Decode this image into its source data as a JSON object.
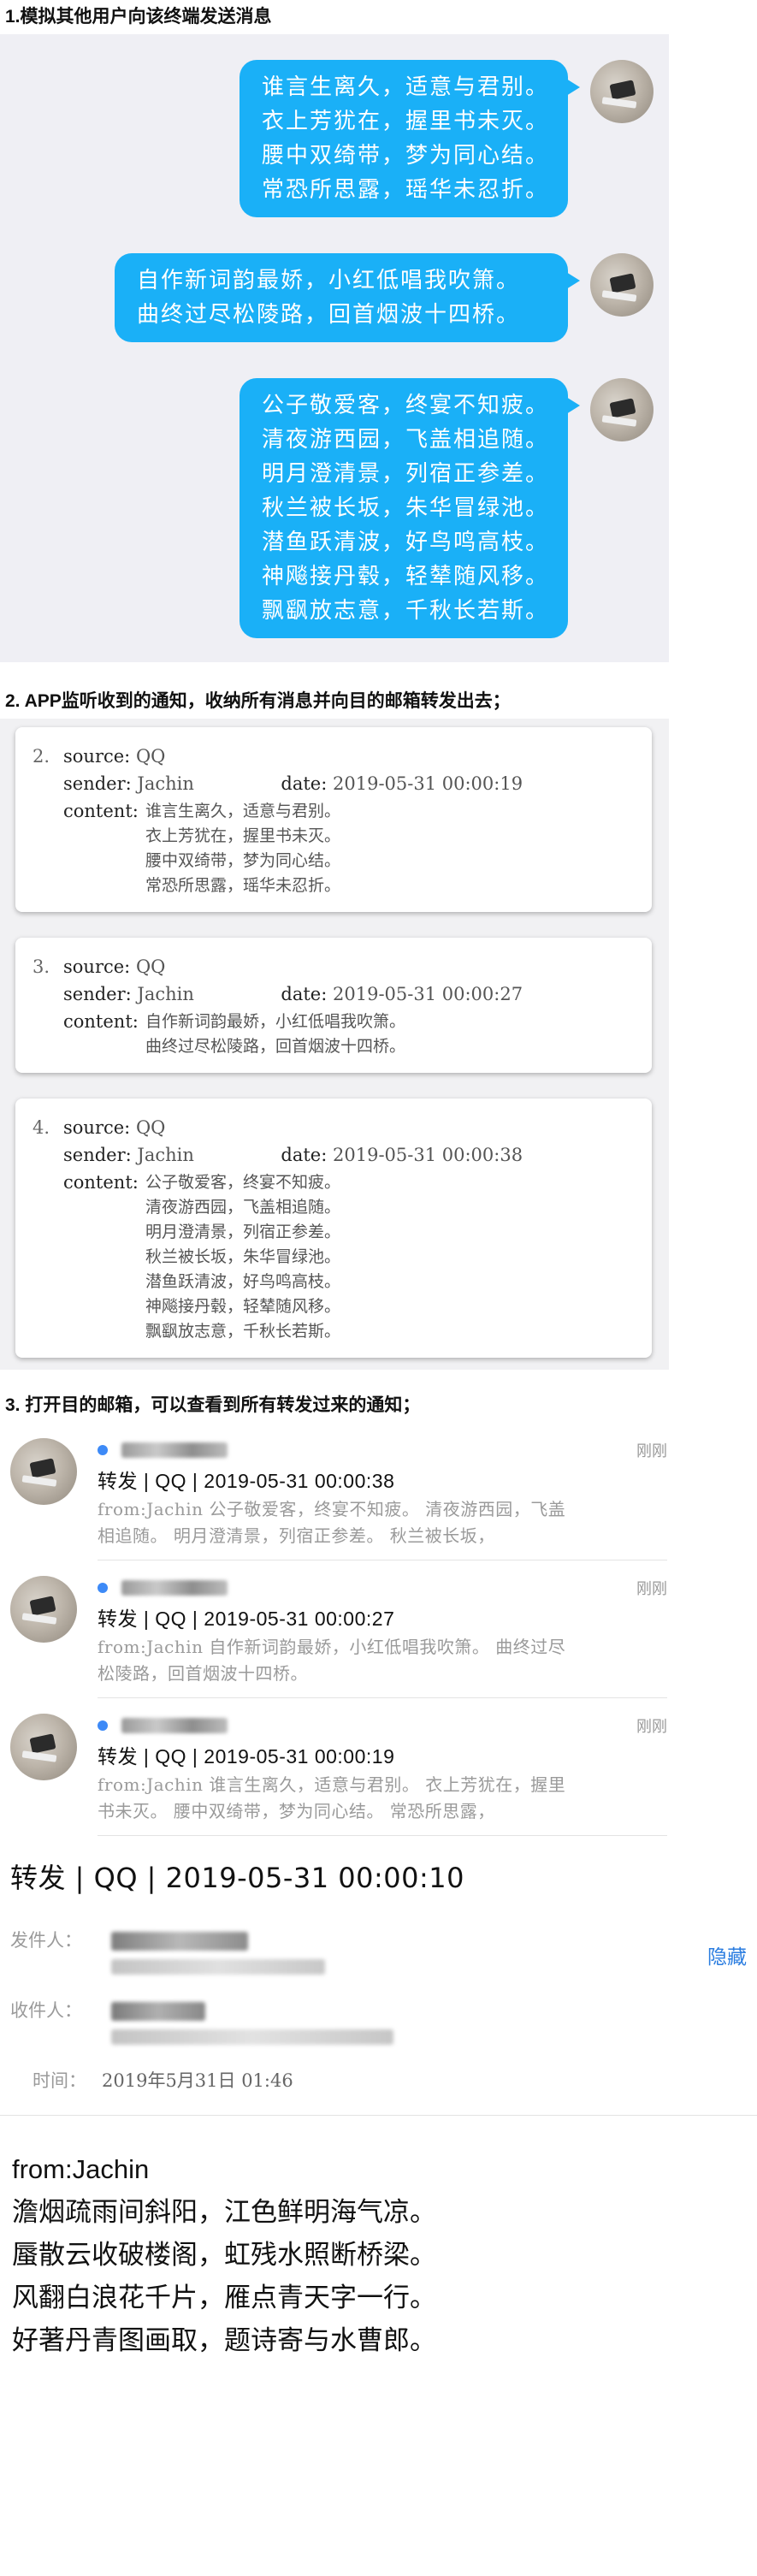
{
  "section1": {
    "title": "1.模拟其他用户向该终端发送消息",
    "messages": [
      {
        "lines": [
          "谁言生离久，适意与君别。",
          "衣上芳犹在，握里书未灭。",
          "腰中双绮带，梦为同心结。",
          "常恐所思露，瑶华未忍折。"
        ]
      },
      {
        "lines": [
          "自作新词韵最娇，小红低唱我吹箫。",
          "曲终过尽松陵路，回首烟波十四桥。"
        ]
      },
      {
        "lines": [
          "公子敬爱客，终宴不知疲。",
          "清夜游西园，飞盖相追随。",
          "明月澄清景，列宿正参差。",
          "秋兰被长坂，朱华冒绿池。",
          "潜鱼跃清波，好鸟鸣高枝。",
          "神飚接丹毂，轻辇随风移。",
          "飘飖放志意，千秋长若斯。"
        ]
      }
    ]
  },
  "section2": {
    "title": "2. APP监听收到的通知，收纳所有消息并向目的邮箱转发出去；",
    "labels": {
      "source": "source:",
      "sender": "sender:",
      "date": "date:",
      "content": "content:"
    },
    "cards": [
      {
        "num": "2.",
        "source": "QQ",
        "sender": "Jachin",
        "date": "2019-05-31 00:00:19",
        "content": [
          "谁言生离久，适意与君别。",
          "衣上芳犹在，握里书未灭。",
          "腰中双绮带，梦为同心结。",
          "常恐所思露，瑶华未忍折。"
        ]
      },
      {
        "num": "3.",
        "source": "QQ",
        "sender": "Jachin",
        "date": "2019-05-31 00:00:27",
        "content": [
          "自作新词韵最娇，小红低唱我吹箫。",
          "曲终过尽松陵路，回首烟波十四桥。"
        ]
      },
      {
        "num": "4.",
        "source": "QQ",
        "sender": "Jachin",
        "date": "2019-05-31 00:00:38",
        "content": [
          "公子敬爱客，终宴不知疲。",
          "清夜游西园，飞盖相追随。",
          "明月澄清景，列宿正参差。",
          "秋兰被长坂，朱华冒绿池。",
          "潜鱼跃清波，好鸟鸣高枝。",
          "神飚接丹毂，轻辇随风移。",
          "飘飖放志意，千秋长若斯。"
        ]
      }
    ]
  },
  "section3": {
    "title": "3. 打开目的邮箱，可以查看到所有转发过来的通知；",
    "mails": [
      {
        "time": "刚刚",
        "subject": "转发 | QQ | 2019-05-31 00:00:38",
        "preview": [
          "from:Jachin 公子敬爱客，终宴不知疲。 清夜游西园，飞盖",
          "相追随。 明月澄清景，列宿正参差。 秋兰被长坂，"
        ]
      },
      {
        "time": "刚刚",
        "subject": "转发 | QQ | 2019-05-31 00:00:27",
        "preview": [
          "from:Jachin 自作新词韵最娇，小红低唱我吹箫。 曲终过尽",
          "松陵路，回首烟波十四桥。"
        ]
      },
      {
        "time": "刚刚",
        "subject": "转发 | QQ | 2019-05-31 00:00:19",
        "preview": [
          "from:Jachin 谁言生离久，适意与君别。 衣上芳犹在，握里",
          "书未灭。 腰中双绮带，梦为同心结。 常恐所思露，"
        ]
      }
    ]
  },
  "open_mail": {
    "subject": "转发 | QQ | 2019-05-31 00:00:10",
    "sender_label": "发件人：",
    "recipient_label": "收件人：",
    "hide_label": "隐藏",
    "time_label": "时间：",
    "time_value": "2019年5月31日 01:46",
    "content_from": "from:Jachin",
    "content_lines": [
      "澹烟疏雨间斜阳，江色鲜明海气凉。",
      "蜃散云收破楼阁，虹残水照断桥梁。",
      "风翻白浪花千片，雁点青天字一行。",
      "好著丹青图画取，题诗寄与水曹郎。"
    ]
  },
  "colors": {
    "bubble": "#1ab0f7",
    "chat_bg": "#efeff4",
    "link": "#2b7de0",
    "unread_dot": "#3d8af7"
  }
}
